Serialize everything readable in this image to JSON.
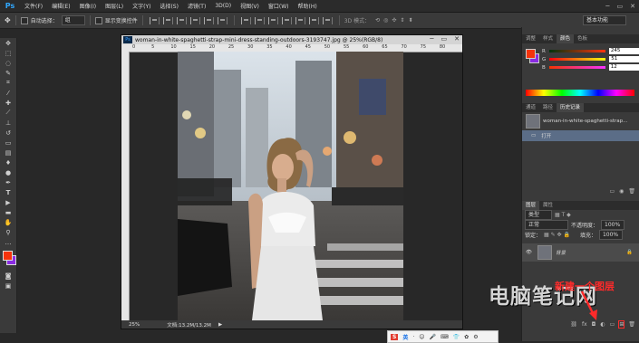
{
  "app": {
    "logo": "Ps"
  },
  "menubar": {
    "items": [
      "文件(F)",
      "编辑(E)",
      "图像(I)",
      "图层(L)",
      "文字(Y)",
      "选择(S)",
      "滤镜(T)",
      "3D(D)",
      "视图(V)",
      "窗口(W)",
      "帮助(H)"
    ],
    "window_controls": {
      "minimize": "─",
      "restore": "▭",
      "close": "✕"
    }
  },
  "options_bar": {
    "auto_select_label": "自动选择：",
    "auto_select_value": "组",
    "show_transform_label": "显示变换控件",
    "mode_3d_label": "3D 模式：",
    "workspace": "基本功能"
  },
  "document": {
    "title": "woman-in-white-spaghetti-strap-mini-dress-standing-outdoors-3193747.jpg @ 25%(RGB/8)",
    "ruler_marks": [
      "0",
      "5",
      "10",
      "15",
      "20",
      "25",
      "30",
      "35",
      "40",
      "45",
      "50",
      "55",
      "60",
      "65",
      "70",
      "75",
      "80"
    ],
    "zoom": "25%",
    "doc_size": "文档:13.2M/13.2M"
  },
  "color_panel": {
    "tabs": [
      "颜色",
      "色板"
    ],
    "prefix_tabs": [
      "调整",
      "样式"
    ],
    "r": "245",
    "g": "51",
    "b": "12",
    "fg_color": "#f5330c",
    "bg_color": "#8a2be2"
  },
  "history_panel": {
    "tabs": [
      "通道",
      "路径",
      "历史记录"
    ],
    "snapshot_name": "woman-in-white-spaghetti-strap...",
    "items": [
      "打开"
    ]
  },
  "layers_panel": {
    "tabs": [
      "图层",
      "属性"
    ],
    "kind_label": "类型",
    "blend_mode": "正常",
    "opacity_label": "不透明度：",
    "opacity": "100%",
    "lock_label": "锁定：",
    "fill_label": "填充：",
    "fill": "100%",
    "layers": [
      {
        "name": "背景"
      }
    ]
  },
  "annotation": "新建一个图层",
  "watermark": "电脑笔记网",
  "ime": {
    "items": [
      "S",
      "英",
      "·",
      "☺",
      "🎤",
      "⌨",
      "👕",
      "✿",
      "⚙"
    ]
  },
  "colors": {
    "accent": "#ff2a2a",
    "panel": "#3a3a3a",
    "dark": "#282828"
  }
}
